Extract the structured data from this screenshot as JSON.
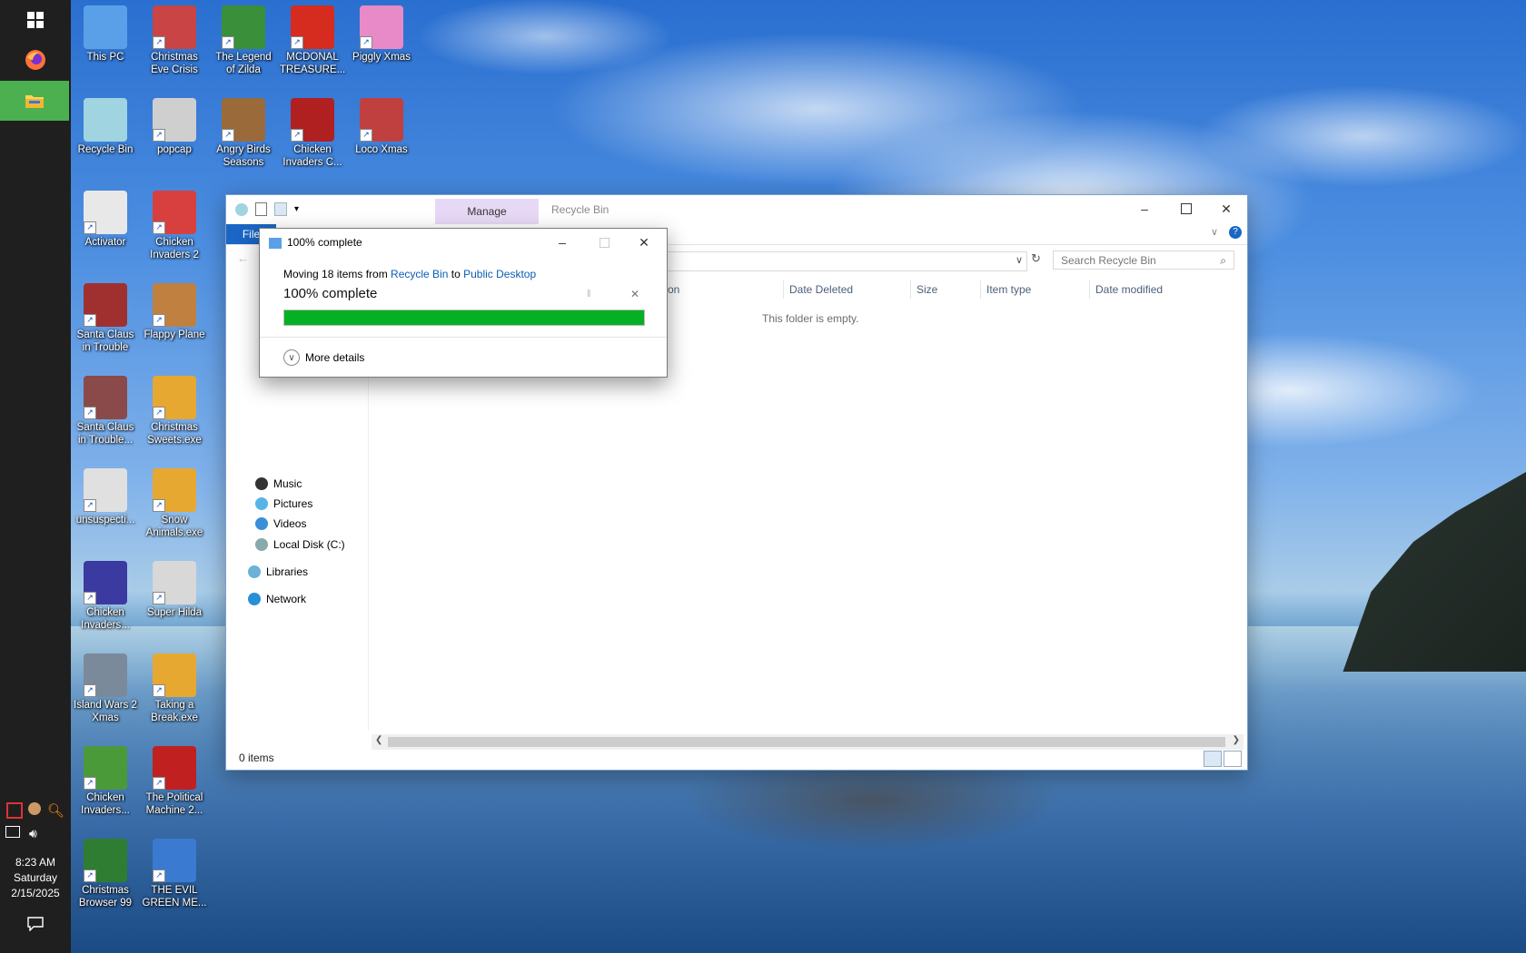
{
  "taskbar": {
    "buttons": [
      {
        "name": "start-button",
        "icon": "windows-logo-icon"
      },
      {
        "name": "firefox-button",
        "icon": "firefox-icon"
      },
      {
        "name": "file-explorer-button",
        "icon": "folder-icon",
        "active": true
      }
    ],
    "tray_icons": [
      "antivirus-icon",
      "game-icon",
      "search-icon",
      "network-icon",
      "volume-icon"
    ],
    "clock": {
      "time": "8:23 AM",
      "day": "Saturday",
      "date": "2/15/2025"
    },
    "notification_icon": "action-center-icon"
  },
  "desktop_icons": [
    {
      "label": "This PC",
      "color": "#5aa0e8"
    },
    {
      "label": "Christmas Eve Crisis",
      "color": "#c94444"
    },
    {
      "label": "The Legend of Zilda",
      "color": "#3a8f3a"
    },
    {
      "label": "MCDONAL TREASURE...",
      "color": "#d62b1f"
    },
    {
      "label": "Piggly Xmas",
      "color": "#e889c8"
    },
    {
      "label": "Recycle Bin",
      "color": "#9fd4e0"
    },
    {
      "label": "popcap",
      "color": "#cfcfcf"
    },
    {
      "label": "Angry Birds Seasons",
      "color": "#9a6a3a"
    },
    {
      "label": "Chicken Invaders C...",
      "color": "#b02020"
    },
    {
      "label": "Loco Xmas",
      "color": "#c04040"
    },
    {
      "label": "Activator",
      "color": "#e8e8e8"
    },
    {
      "label": "Chicken Invaders 2",
      "color": "#d84040"
    },
    {
      "label": "Santa Claus in Trouble",
      "color": "#a03030"
    },
    {
      "label": "Flappy Plane",
      "color": "#c08040"
    },
    {
      "label": "Santa Claus in Trouble...",
      "color": "#8a4a4a"
    },
    {
      "label": "Christmas Sweets.exe",
      "color": "#e6a830"
    },
    {
      "label": "unsuspecti...",
      "color": "#e0e0e0"
    },
    {
      "label": "Snow Animals.exe",
      "color": "#e6a830"
    },
    {
      "label": "Chicken Invaders...",
      "color": "#3a3aa0"
    },
    {
      "label": "Super Hilda",
      "color": "#d8d8d8"
    },
    {
      "label": "Island Wars 2 Xmas",
      "color": "#7a8a9a"
    },
    {
      "label": "Taking a Break.exe",
      "color": "#e6a830"
    },
    {
      "label": "Chicken Invaders...",
      "color": "#4a9a3a"
    },
    {
      "label": "The Political Machine 2...",
      "color": "#c02020"
    },
    {
      "label": "Christmas Browser 99",
      "color": "#2e7d32"
    },
    {
      "label": "THE EVIL GREEN ME...",
      "color": "#3a7ad0"
    }
  ],
  "explorer": {
    "title": "Recycle Bin",
    "manage_tab": "Manage",
    "file_tab": "File",
    "search_placeholder": "Search Recycle Bin",
    "columns": [
      "on",
      "Date Deleted",
      "Size",
      "Item type",
      "Date modified"
    ],
    "empty_message": "This folder is empty.",
    "nav_items": [
      "Music",
      "Pictures",
      "Videos",
      "Local Disk (C:)",
      "Libraries",
      "Network"
    ],
    "status": "0 items"
  },
  "progress_dialog": {
    "title": "100% complete",
    "message_prefix": "Moving 18 items from",
    "source": "Recycle Bin",
    "connector": "to",
    "destination": "Public Desktop",
    "big_status": "100% complete",
    "progress": 1.0,
    "more_details": "More details",
    "accent": "#06b025"
  }
}
